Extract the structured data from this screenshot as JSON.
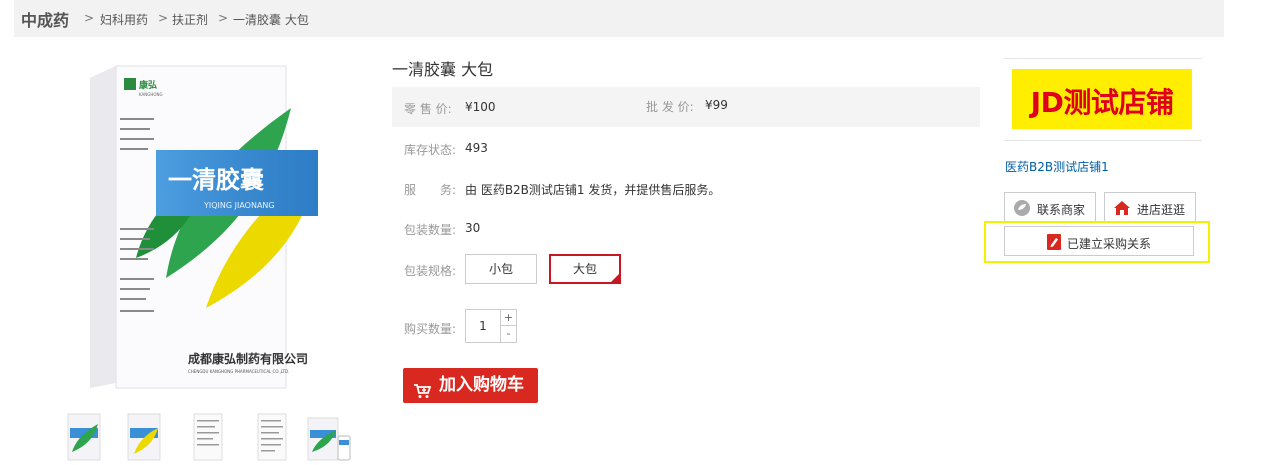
{
  "breadcrumb": {
    "category": "中成药",
    "items": [
      "妇科用药",
      "扶正剂",
      "一清胶囊 大包"
    ],
    "separator": ">"
  },
  "product": {
    "title": "一清胶囊 大包",
    "retail_price_label": "零 售 价:",
    "retail_price": "¥100",
    "wholesale_price_label": "批 发 价:",
    "wholesale_price": "¥99",
    "stock_label": "库存状态:",
    "stock": "493",
    "service_label": "服　　务:",
    "service_text": "由 医药B2B测试店铺1 发货，并提供售后服务。",
    "pack_count_label": "包装数量:",
    "pack_count": "30",
    "spec_label": "包装规格:",
    "specs": [
      {
        "label": "小包",
        "selected": false
      },
      {
        "label": "大包",
        "selected": true
      }
    ],
    "quantity_label": "购买数量:",
    "quantity": "1",
    "plus": "+",
    "minus": "-",
    "add_to_cart": "加入购物车"
  },
  "box_art": {
    "brand": "康弘",
    "brand_en": "KANGHONG",
    "name": "一清胶囊",
    "name_pinyin": "YIQING JIAONANG",
    "company": "成都康弘制药有限公司",
    "company_en": "CHENGDU KANGHONG PHARMACEUTICAL CO.,LTD."
  },
  "shop": {
    "logo_text": "JD测试店铺",
    "name": "医药B2B测试店铺1",
    "contact_label": "联系商家",
    "visit_label": "进店逛逛",
    "relation_label": "已建立采购关系"
  },
  "colors": {
    "accent_red": "#d9281f",
    "link_blue": "#005ea7",
    "logo_yellow": "#ffee00",
    "highlight_yellow": "#f5f000"
  }
}
